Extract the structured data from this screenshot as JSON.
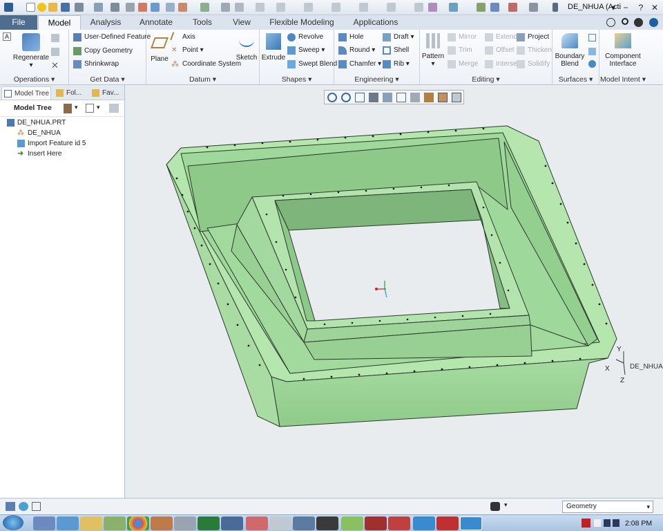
{
  "window": {
    "title": "DE_NHUA (Acti",
    "controls": [
      "−",
      "▾",
      "?",
      "✕"
    ]
  },
  "tabs": [
    {
      "label": "File"
    },
    {
      "label": "Model"
    },
    {
      "label": "Analysis"
    },
    {
      "label": "Annotate"
    },
    {
      "label": "Tools"
    },
    {
      "label": "View"
    },
    {
      "label": "Flexible Modeling"
    },
    {
      "label": "Applications"
    }
  ],
  "ribbon": {
    "operations": {
      "label": "Operations ▾",
      "regenerate": "Regenerate"
    },
    "get_data": {
      "label": "Get Data ▾",
      "udf": "User-Defined Feature",
      "copy_geometry": "Copy Geometry",
      "shrinkwrap": "Shrinkwrap"
    },
    "datum": {
      "label": "Datum ▾",
      "plane": "Plane",
      "axis": "Axis",
      "point": "Point ▾",
      "csys": "Coordinate System",
      "sketch": "Sketch"
    },
    "shapes": {
      "label": "Shapes ▾",
      "extrude": "Extrude",
      "revolve": "Revolve",
      "sweep": "Sweep ▾",
      "swept_blend": "Swept Blend"
    },
    "engineering": {
      "label": "Engineering ▾",
      "hole": "Hole",
      "round": "Round ▾",
      "chamfer": "Chamfer ▾",
      "draft": "Draft ▾",
      "shell": "Shell",
      "rib": "Rib ▾"
    },
    "editing": {
      "label": "Editing ▾",
      "pattern": "Pattern",
      "mirror": "Mirror",
      "trim": "Trim",
      "merge": "Merge",
      "extend": "Extend",
      "offset": "Offset",
      "intersect": "Intersect",
      "project": "Project",
      "thicken": "Thicken",
      "solidify": "Solidify"
    },
    "surfaces": {
      "label": "Surfaces ▾",
      "boundary_blend": "Boundary",
      "boundary_blend2": "Blend"
    },
    "model_intent": {
      "label": "Model Intent ▾",
      "component_interface": "Component",
      "component_interface2": "Interface"
    }
  },
  "left_panel": {
    "tabs": [
      "Model Tree",
      "Fol...",
      "Fav..."
    ],
    "header": "Model Tree",
    "tree": [
      {
        "label": "DE_NHUA.PRT"
      },
      {
        "label": "DE_NHUA"
      },
      {
        "label": "Import Feature id 5"
      },
      {
        "label": "Insert Here"
      }
    ]
  },
  "graphics": {
    "csys_label": "DE_NHUA",
    "axes": {
      "x": "X",
      "y": "Y",
      "z": "Z"
    },
    "model_color": "#9fd89b"
  },
  "status_bar": {
    "filter_value": "Geometry"
  },
  "taskbar": {
    "time": "2:08 PM"
  }
}
